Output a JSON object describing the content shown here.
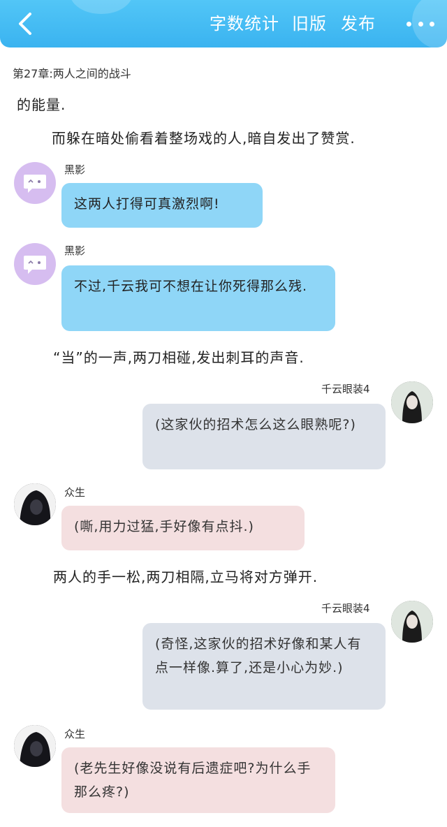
{
  "topbar": {
    "actions": [
      "字数统计",
      "旧版",
      "发布"
    ],
    "accent_color": "#3ab3f0"
  },
  "chapter": {
    "title": "第27章:两人之间的战斗"
  },
  "narrations": [
    "的能量.",
    "而躲在暗处偷看着整场戏的人,暗自发出了赞赏.",
    "“当”的一声,两刀相碰,发出刺耳的声音.",
    "两人的手一松,两刀相隔,立马将对方弹开."
  ],
  "messages": [
    {
      "speaker": "黑影",
      "text": "这两人打得可真激烈啊!"
    },
    {
      "speaker": "黑影",
      "text": "不过,千云我可不想在让你死得那么残."
    },
    {
      "speaker": "千云眼装4",
      "text": "(这家伙的招术怎么这么眼熟呢?)"
    },
    {
      "speaker": "众生",
      "text": "(嘶,用力过猛,手好像有点抖.)"
    },
    {
      "speaker": "千云眼装4",
      "text": "(奇怪,这家伙的招术好像和某人有点一样像.算了,还是小心为妙.)"
    },
    {
      "speaker": "众生",
      "text": "(老先生好像没说有后遗症吧?为什么手那么疼?)"
    }
  ]
}
